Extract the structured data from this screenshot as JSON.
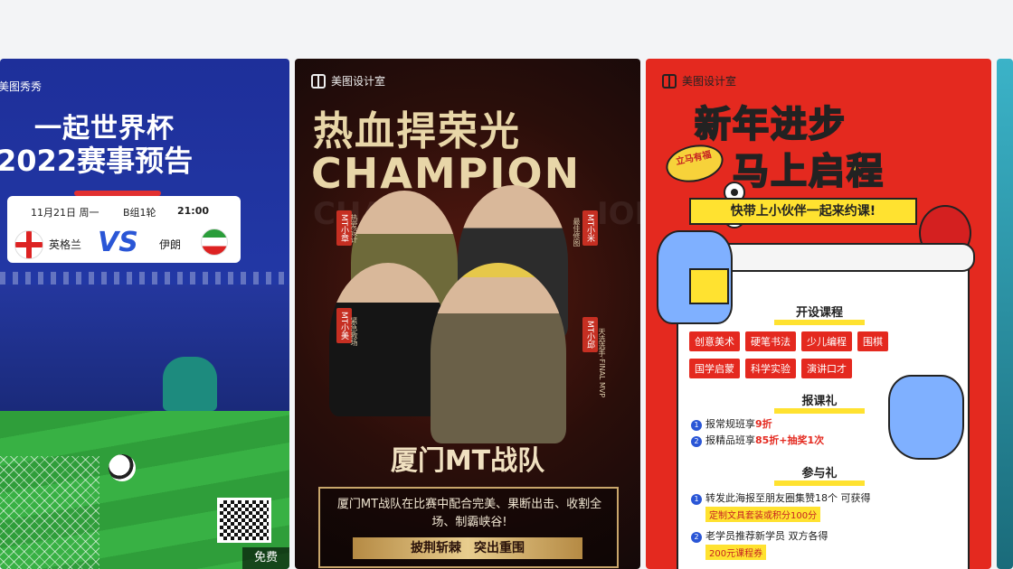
{
  "card1": {
    "brand": "美图秀秀",
    "title_line1": "一起世界杯",
    "title_line2": "2022赛事预告",
    "match": {
      "date": "11月21日 周一",
      "group": "B组1轮",
      "time": "21:00",
      "team1": "英格兰",
      "vs": "VS",
      "team2": "伊朗"
    },
    "badge": "免费"
  },
  "card2": {
    "brand": "美图设计室",
    "title": "热血捍荣光",
    "champion": "CHAMPION",
    "watermark_left": "CHAMP",
    "watermark_right": "ION",
    "tags": [
      "MT小章",
      "MT小米",
      "MT小美",
      "MT小邱"
    ],
    "subtags": [
      "热爱设计",
      "最佳修图",
      "紧急救场",
      "天选选手·FINAL MVP"
    ],
    "team": "厦门MT战队",
    "description": "厦门MT战队在比赛中配合完美、果断出击、收割全场、制霸峡谷!",
    "slogan": "披荆斩棘　突出重围"
  },
  "card3": {
    "brand": "美图设计室",
    "title_line1": "新年进步",
    "title_line2": "马上启程",
    "badge": "立马有福",
    "strip": "快带上小伙伴一起来约课!",
    "section1": "开设课程",
    "courses": [
      "创意美术",
      "硬笔书法",
      "少儿编程",
      "围棋",
      "国学启蒙",
      "科学实验",
      "演讲口才"
    ],
    "section2": "报课礼",
    "gift1_text": "报常规班享",
    "gift1_hl": "9折",
    "gift2_text": "报精品班享",
    "gift2_hl": "85折+抽奖1次",
    "section3": "参与礼",
    "join1": "转发此海报至朋友圈集赞18个 可获得",
    "join1_sub": "定制文具套装或积分100分",
    "join2": "老学员推荐新学员 双方各得",
    "join2_sub": "200元课程券"
  },
  "colors": {
    "card1_bg": "#233aa8",
    "card2_bg": "#2a0e0a",
    "card3_bg": "#e4291f",
    "gold": "#e8d6a8"
  }
}
